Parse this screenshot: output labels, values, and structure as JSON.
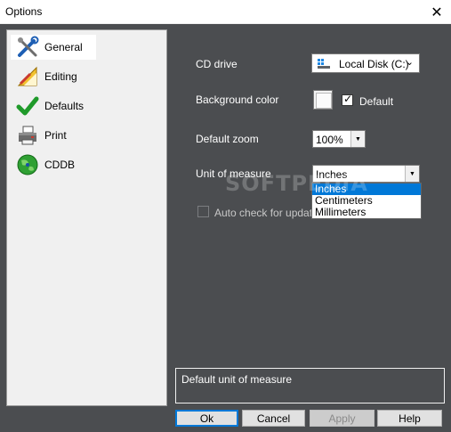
{
  "window": {
    "title": "Options",
    "close_glyph": "✕"
  },
  "sidebar": {
    "items": [
      {
        "label": "General",
        "icon": "tools-icon",
        "selected": true
      },
      {
        "label": "Editing",
        "icon": "ruler-pencil-icon",
        "selected": false
      },
      {
        "label": "Defaults",
        "icon": "checkmark-icon",
        "selected": false
      },
      {
        "label": "Print",
        "icon": "printer-icon",
        "selected": false
      },
      {
        "label": "CDDB",
        "icon": "globe-disc-icon",
        "selected": false
      }
    ]
  },
  "general": {
    "cd_drive_label": "CD drive",
    "cd_drive_value": "Local Disk (C:)",
    "background_color_label": "Background color",
    "background_default_label": "Default",
    "background_default_checked": true,
    "default_zoom_label": "Default zoom",
    "default_zoom_value": "100%",
    "unit_label": "Unit of measure",
    "unit_value": "Inches",
    "unit_options": [
      "Inches",
      "Centimeters",
      "Millimeters"
    ],
    "unit_highlighted": "Inches",
    "auto_check_label": "Auto check for updat"
  },
  "watermark": "SOFTPEDIA",
  "description": "Default unit of measure",
  "buttons": {
    "ok": "Ok",
    "cancel": "Cancel",
    "apply": "Apply",
    "help": "Help"
  },
  "colors": {
    "panel_bg": "#4b4d50",
    "selection": "#0078d7",
    "sidebar_bg": "#f0f0f0"
  }
}
